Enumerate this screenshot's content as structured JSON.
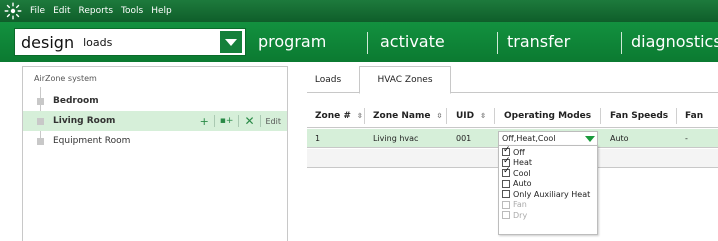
{
  "menubar": {
    "items": [
      "File",
      "Edit",
      "Reports",
      "Tools",
      "Help"
    ]
  },
  "nav": {
    "design_label": "design",
    "design_select_value": "loads",
    "tabs": [
      "program",
      "activate",
      "transfer",
      "diagnostics"
    ]
  },
  "tree": {
    "root": "AirZone system",
    "items": [
      {
        "label": "Bedroom",
        "selected": false,
        "bold": true
      },
      {
        "label": "Living Room",
        "selected": true,
        "bold": true
      },
      {
        "label": "Equipment Room",
        "selected": false,
        "bold": false
      }
    ],
    "actions": {
      "add": "+",
      "add_sub": "▪+",
      "delete": "✕",
      "edit": "Edit"
    }
  },
  "tabs": {
    "items": [
      "Loads",
      "HVAC Zones"
    ],
    "active": "HVAC Zones"
  },
  "grid": {
    "headers": [
      "Zone #",
      "Zone Name",
      "UID",
      "Operating Modes",
      "Fan Speeds",
      "Fan"
    ],
    "sort_icon": "⇳",
    "rows": [
      {
        "zone_num": "1",
        "zone_name": "Living hvac",
        "uid": "001",
        "operating_modes": "Off,Heat,Cool",
        "fan_speeds": "Auto",
        "fan": "-"
      }
    ]
  },
  "dropdown": {
    "options": [
      {
        "label": "Off",
        "checked": true,
        "disabled": false
      },
      {
        "label": "Heat",
        "checked": true,
        "disabled": false
      },
      {
        "label": "Cool",
        "checked": true,
        "disabled": false
      },
      {
        "label": "Auto",
        "checked": false,
        "disabled": false
      },
      {
        "label": "Only Auxiliary Heat",
        "checked": false,
        "disabled": false
      },
      {
        "label": "Fan",
        "checked": false,
        "disabled": true
      },
      {
        "label": "Dry",
        "checked": false,
        "disabled": true
      }
    ]
  },
  "colors": {
    "brand_green": "#13913f",
    "selection_green": "#d6efd9",
    "accent_green": "#1a9a3c"
  }
}
